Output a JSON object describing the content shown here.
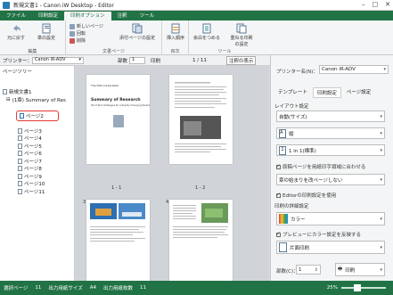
{
  "window": {
    "title": "新規文書1 - Canon iW Desktop - Editor",
    "minimize": "–",
    "maximize": "□",
    "close": "✕"
  },
  "tabs": [
    "ファイル",
    "印刷設定",
    "印刷オプション",
    "注釈",
    "ツール"
  ],
  "active_tab": 2,
  "ribbon": {
    "undo": "元に戻す",
    "redo": "やり直し",
    "new_page": "新しいページ",
    "rotate": "回転",
    "delete": "削除",
    "copy_page": "章の設定",
    "insert_page": "添付ページの設定",
    "insert_order": "挿入順序",
    "index": "目次",
    "combine_file": "余白をつめる",
    "duplex_print": "重ねる印刷\nの設定",
    "group_edit": "編集",
    "group_page": "文書ページ",
    "group_index": "目次",
    "group_tool": "ツール"
  },
  "printer_row": {
    "label": "プリンター：",
    "printer": "Canon iR-ADV",
    "pages_label": "部数",
    "pages_value": "1",
    "print_btn": "印刷",
    "page_num": "1 / 11",
    "annotation_toggle": "注釈の表示"
  },
  "tree": {
    "header": "ページツリー",
    "doc": "新規文書1",
    "chapter": "(1章) Summary of Res",
    "pages": [
      "ページ2",
      "ページ3",
      "ページ4",
      "ページ5",
      "ページ6",
      "ページ7",
      "ページ8",
      "ページ9",
      "ページ10",
      "ページ11"
    ]
  },
  "preview": {
    "page_labels": [
      "1 - 1",
      "1 - 2",
      "3",
      "4"
    ],
    "page1_header": "The DSS Corporation",
    "page1_title": "Summary of Research",
    "page1_sub": "Short Term Strategies for a Rapidly Changing Market"
  },
  "right_panel": {
    "printer_label": "プリンター名(N)：",
    "printer_value": "Canon iR-ADV",
    "subtabs": [
      "テンプレート",
      "印刷設定",
      "ページ設定"
    ],
    "layout_header": "レイアウト設定",
    "paper_size": "自動(サイズ)",
    "orientation": "縦",
    "pages_per_sheet": "1 in 1(標準)",
    "fit_check": "原稿ページを用紙印字領域に合わせる",
    "fit_combo": "章の始まりを改ページしない",
    "editor_check": "Editorの印刷設定を使用",
    "detail_header": "印刷の詳細設定",
    "color": "カラー",
    "preview_check": "プレビューにカラー設定を反映する",
    "duplex": "片面印刷",
    "copies_label": "部数(C)：",
    "copies_value": "1",
    "print_button": "印刷"
  },
  "status": {
    "selected": "選択ページ",
    "page_count": "11",
    "output_size_label": "出力用紙サイズ",
    "output_size": "A4",
    "output_pages_label": "出力用紙枚数",
    "output_pages": "11",
    "zoom": "25%"
  },
  "colors": {
    "accent": "#217346",
    "highlight": "#e53935"
  }
}
